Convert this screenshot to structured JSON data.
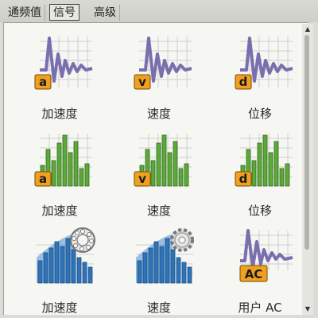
{
  "tabs": [
    {
      "label": "通频值",
      "active": false
    },
    {
      "label": "信号",
      "active": true
    },
    {
      "label": "高级",
      "active": false
    }
  ],
  "items": [
    {
      "label": "加速度",
      "badge": "a",
      "icon": "waveform-icon"
    },
    {
      "label": "速度",
      "badge": "v",
      "icon": "waveform-icon"
    },
    {
      "label": "位移",
      "badge": "d",
      "icon": "waveform-icon"
    },
    {
      "label": "加速度",
      "badge": "a",
      "icon": "spectrum-icon"
    },
    {
      "label": "速度",
      "badge": "v",
      "icon": "spectrum-icon"
    },
    {
      "label": "位移",
      "badge": "d",
      "icon": "spectrum-icon"
    },
    {
      "label": "加速度",
      "badge": "",
      "icon": "bearing-spectrum-icon"
    },
    {
      "label": "速度",
      "badge": "",
      "icon": "gear-spectrum-icon"
    },
    {
      "label": "用户 AC",
      "badge": "AC",
      "icon": "waveform-icon"
    }
  ],
  "colors": {
    "wave": "#7a6fae",
    "bars_green": "#5ea83a",
    "bars_blue": "#2f73b8",
    "badge": "#f0a020",
    "grid": "#c9c9c9"
  }
}
